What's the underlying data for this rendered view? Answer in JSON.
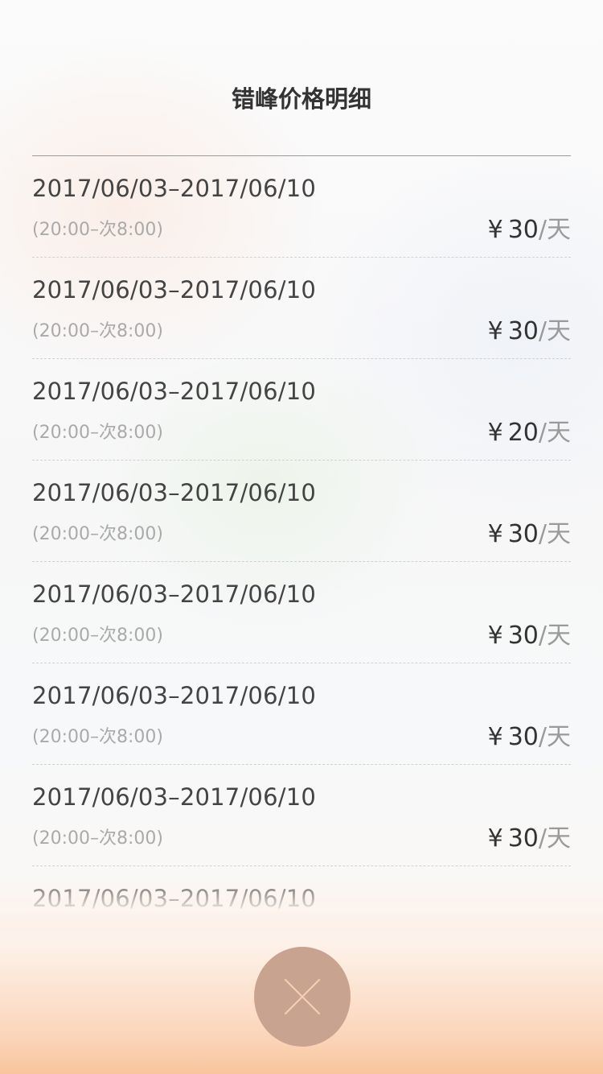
{
  "header": {
    "title": "错峰价格明细"
  },
  "rows": [
    {
      "date_range": "2017/06/03–2017/06/10",
      "time_range": "(20:00–次8:00)",
      "currency": "¥",
      "amount": "30",
      "unit": "/天"
    },
    {
      "date_range": "2017/06/03–2017/06/10",
      "time_range": "(20:00–次8:00)",
      "currency": "¥",
      "amount": "30",
      "unit": "/天"
    },
    {
      "date_range": "2017/06/03–2017/06/10",
      "time_range": "(20:00–次8:00)",
      "currency": "¥",
      "amount": "20",
      "unit": "/天"
    },
    {
      "date_range": "2017/06/03–2017/06/10",
      "time_range": "(20:00–次8:00)",
      "currency": "¥",
      "amount": "30",
      "unit": "/天"
    },
    {
      "date_range": "2017/06/03–2017/06/10",
      "time_range": "(20:00–次8:00)",
      "currency": "¥",
      "amount": "30",
      "unit": "/天"
    },
    {
      "date_range": "2017/06/03–2017/06/10",
      "time_range": "(20:00–次8:00)",
      "currency": "¥",
      "amount": "30",
      "unit": "/天"
    },
    {
      "date_range": "2017/06/03–2017/06/10",
      "time_range": "(20:00–次8:00)",
      "currency": "¥",
      "amount": "30",
      "unit": "/天"
    },
    {
      "date_range": "2017/06/03–2017/06/10"
    }
  ],
  "close_button": {
    "icon": "close-icon",
    "color": "#c8a390",
    "icon_color": "#f6cdb0"
  },
  "colors": {
    "title": "#333333",
    "date": "#444444",
    "time": "#aaaaaa",
    "unit": "#9a9a9a",
    "bottom_gradient": "#f8c59e"
  }
}
